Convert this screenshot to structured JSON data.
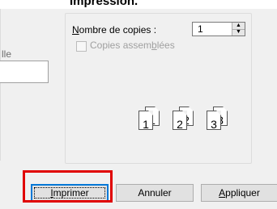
{
  "page": {
    "heading": "Impression."
  },
  "left_panel": {
    "truncated_label": "lle",
    "field_value": ""
  },
  "copies": {
    "label_prefix_underlined": "N",
    "label_rest": "ombre de copies :",
    "value": "1",
    "collate_label_before": "Copies assem",
    "collate_label_underlined": "b",
    "collate_label_after": "lées",
    "collate_checked": false,
    "collate_enabled": false,
    "collation_preview": [
      {
        "left": "1",
        "right": "1"
      },
      {
        "left": "2",
        "right": "2"
      },
      {
        "left": "3",
        "right": "3"
      }
    ]
  },
  "buttons": {
    "print_underlined": "I",
    "print_rest": "mprimer",
    "cancel": "Annuler",
    "apply_underlined": "A",
    "apply_rest": "ppliquer"
  },
  "highlight_color": "#e00000",
  "focus_color": "#0078d7"
}
